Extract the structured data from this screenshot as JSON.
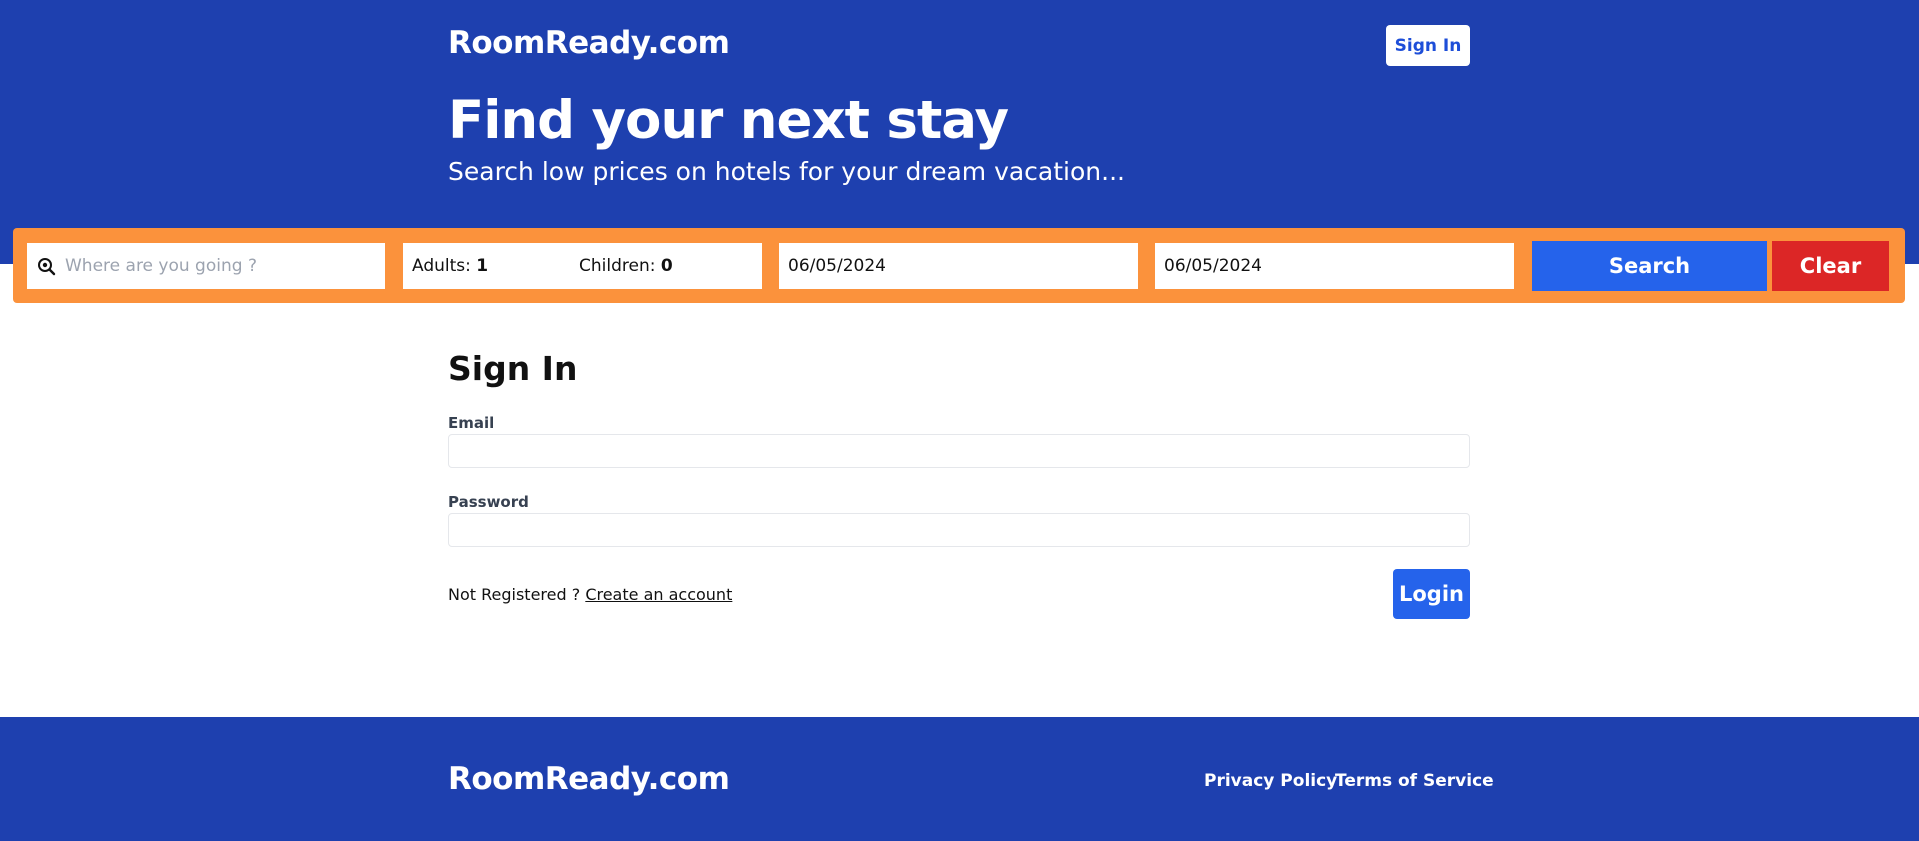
{
  "header": {
    "brand": "RoomReady.com",
    "signin_label": "Sign In",
    "headline": "Find your next stay",
    "subheadline": "Search low prices on hotels for your dream vacation..."
  },
  "search": {
    "destination_placeholder": "Where are you going ?",
    "destination_value": "",
    "adults_label": "Adults:",
    "adults_value": "1",
    "children_label": "Children:",
    "children_value": "0",
    "check_in": "06/05/2024",
    "check_out": "06/05/2024",
    "search_label": "Search",
    "clear_label": "Clear"
  },
  "signin_form": {
    "title": "Sign In",
    "email_label": "Email",
    "email_value": "",
    "password_label": "Password",
    "password_value": "",
    "not_registered_text": "Not Registered ?",
    "create_account_link": "Create an account",
    "login_label": "Login"
  },
  "footer": {
    "brand": "RoomReady.com",
    "links": [
      "Privacy Policy",
      "Terms of Service"
    ]
  },
  "colors": {
    "primary_blue": "#1e40af",
    "button_blue": "#2563eb",
    "search_bar_orange": "#fb923c",
    "clear_red": "#dc2626"
  },
  "icons": {
    "destination": "search-location-icon"
  }
}
